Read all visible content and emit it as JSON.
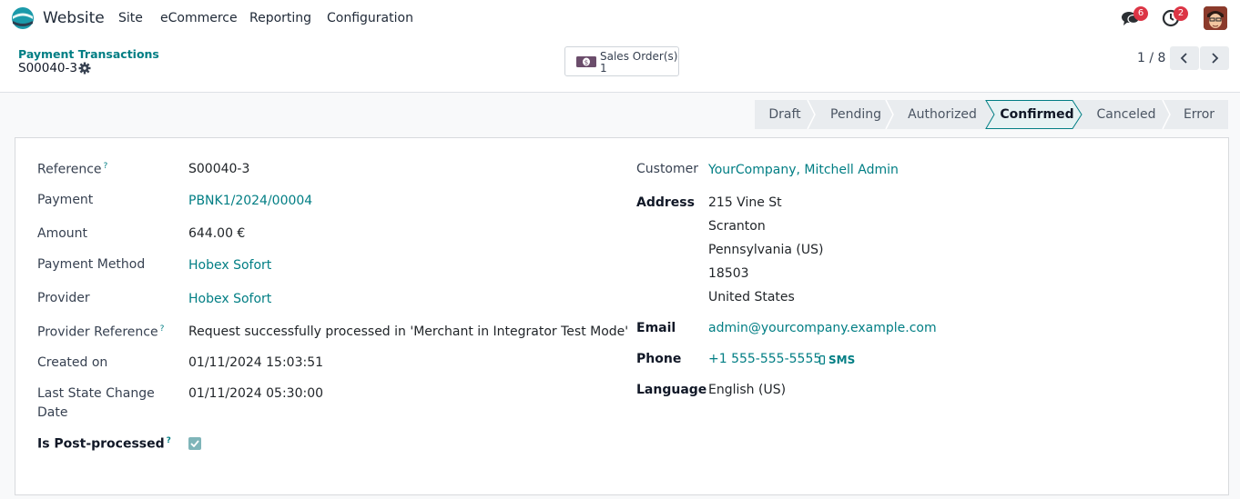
{
  "nav": {
    "app_name": "Website",
    "menu": [
      "Site",
      "eCommerce",
      "Reporting",
      "Configuration"
    ],
    "messages_count": "6",
    "activities_count": "2"
  },
  "control": {
    "breadcrumb": "Payment Transactions",
    "record_name": "S00040-3",
    "smart_button": {
      "label": "Sales Order(s)",
      "count": "1"
    },
    "pager": "1 / 8"
  },
  "statusbar": {
    "stages": [
      "Draft",
      "Pending",
      "Authorized",
      "Confirmed",
      "Canceled",
      "Error"
    ],
    "active": "Confirmed"
  },
  "form": {
    "left": {
      "reference": {
        "label": "Reference",
        "value": "S00040-3"
      },
      "payment": {
        "label": "Payment",
        "value": "PBNK1/2024/00004"
      },
      "amount": {
        "label": "Amount",
        "value": "644.00 €"
      },
      "payment_method": {
        "label": "Payment Method",
        "value": "Hobex Sofort"
      },
      "provider": {
        "label": "Provider",
        "value": "Hobex Sofort"
      },
      "provider_reference": {
        "label": "Provider Reference",
        "value": "Request successfully processed in 'Merchant in Integrator Test Mode'"
      },
      "created_on": {
        "label": "Created on",
        "value": "01/11/2024 15:03:51"
      },
      "last_state_change": {
        "label_l1": "Last State Change",
        "label_l2": "Date",
        "value": "01/11/2024 05:30:00"
      },
      "is_post_processed": {
        "label": "Is Post-processed",
        "checked": true
      }
    },
    "right": {
      "customer": {
        "label": "Customer",
        "value": "YourCompany, Mitchell Admin"
      },
      "address": {
        "label": "Address",
        "lines": [
          "215 Vine St",
          "Scranton",
          "Pennsylvania (US)",
          "18503",
          "United States"
        ]
      },
      "email": {
        "label": "Email",
        "value": "admin@yourcompany.example.com"
      },
      "phone": {
        "label": "Phone",
        "value": "+1 555-555-5555",
        "sms": "SMS"
      },
      "language": {
        "label": "Language",
        "value": "English (US)"
      }
    },
    "help_mark": "?"
  },
  "colors": {
    "accent": "#017e84",
    "badge": "#dc3545",
    "active_stage_bg": "#e6f2f3"
  }
}
